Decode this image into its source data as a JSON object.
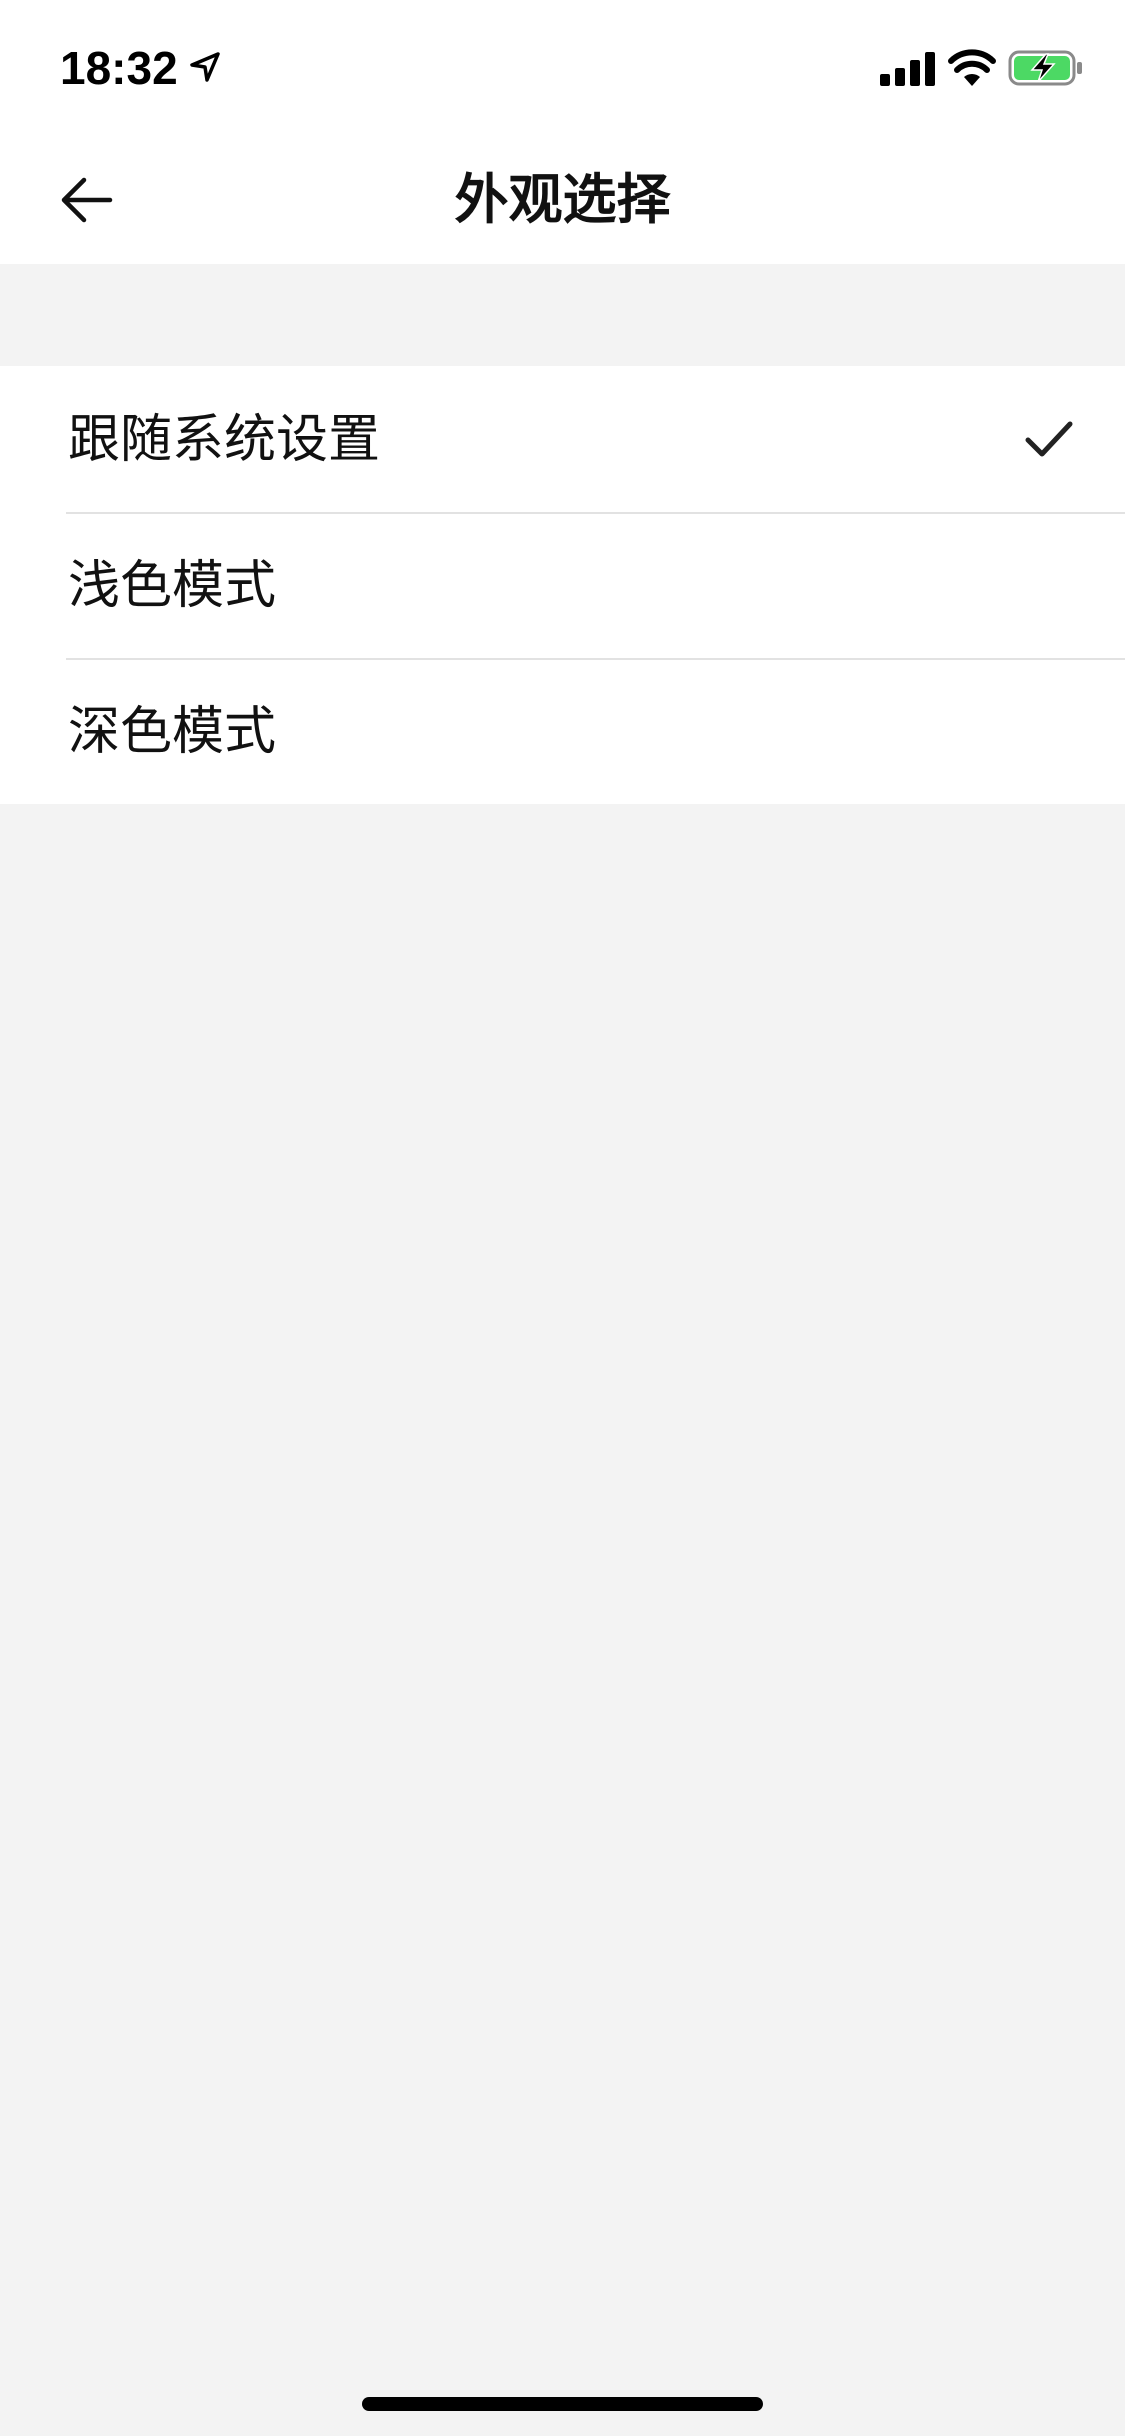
{
  "status_bar": {
    "time": "18:32",
    "icons": [
      "location-arrow-icon",
      "cellular-signal-icon",
      "wifi-icon",
      "battery-charging-icon"
    ],
    "battery_color": "#4cd964"
  },
  "nav": {
    "title": "外观选择",
    "back_icon": "arrow-left-icon"
  },
  "options": [
    {
      "label": "跟随系统设置",
      "selected": true
    },
    {
      "label": "浅色模式",
      "selected": false
    },
    {
      "label": "深色模式",
      "selected": false
    }
  ],
  "colors": {
    "background": "#f3f3f3",
    "surface": "#ffffff",
    "divider": "#e2e2e2",
    "text": "#111111"
  }
}
